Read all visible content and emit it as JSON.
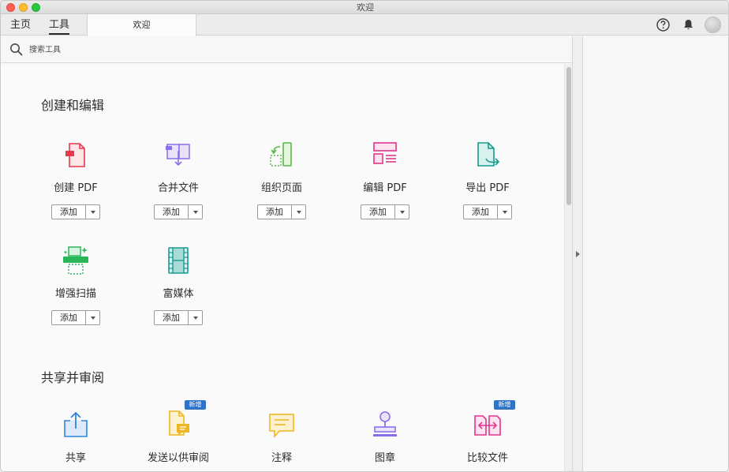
{
  "window": {
    "title": "欢迎"
  },
  "nav": {
    "home": "主页",
    "tools": "工具",
    "doc_tab": "欢迎"
  },
  "search": {
    "placeholder": "搜索工具",
    "value": ""
  },
  "sections": {
    "create_edit": {
      "title": "创建和编辑",
      "tools": [
        {
          "label": "创建 PDF",
          "add": "添加",
          "icon": "create-pdf-icon",
          "color": "#e8394b"
        },
        {
          "label": "合并文件",
          "add": "添加",
          "icon": "combine-files-icon",
          "color": "#8b6ee8"
        },
        {
          "label": "组织页面",
          "add": "添加",
          "icon": "organize-pages-icon",
          "color": "#59b84a"
        },
        {
          "label": "编辑 PDF",
          "add": "添加",
          "icon": "edit-pdf-icon",
          "color": "#e2358d"
        },
        {
          "label": "导出 PDF",
          "add": "添加",
          "icon": "export-pdf-icon",
          "color": "#169b8e"
        },
        {
          "label": "增强扫描",
          "add": "添加",
          "icon": "enhance-scan-icon",
          "color": "#2bb65a"
        },
        {
          "label": "富媒体",
          "add": "添加",
          "icon": "rich-media-icon",
          "color": "#169b8e"
        }
      ]
    },
    "share_review": {
      "title": "共享并审阅",
      "tools": [
        {
          "label": "共享",
          "icon": "share-icon",
          "color": "#2d86de"
        },
        {
          "label": "发送以供审阅",
          "icon": "send-for-review-icon",
          "color": "#f0b623",
          "badge": "新增"
        },
        {
          "label": "注释",
          "icon": "comment-icon",
          "color": "#f0b623"
        },
        {
          "label": "图章",
          "icon": "stamp-icon",
          "color": "#8b6ee8"
        },
        {
          "label": "比较文件",
          "icon": "compare-files-icon",
          "color": "#e2358d",
          "badge": "新增"
        }
      ]
    }
  }
}
